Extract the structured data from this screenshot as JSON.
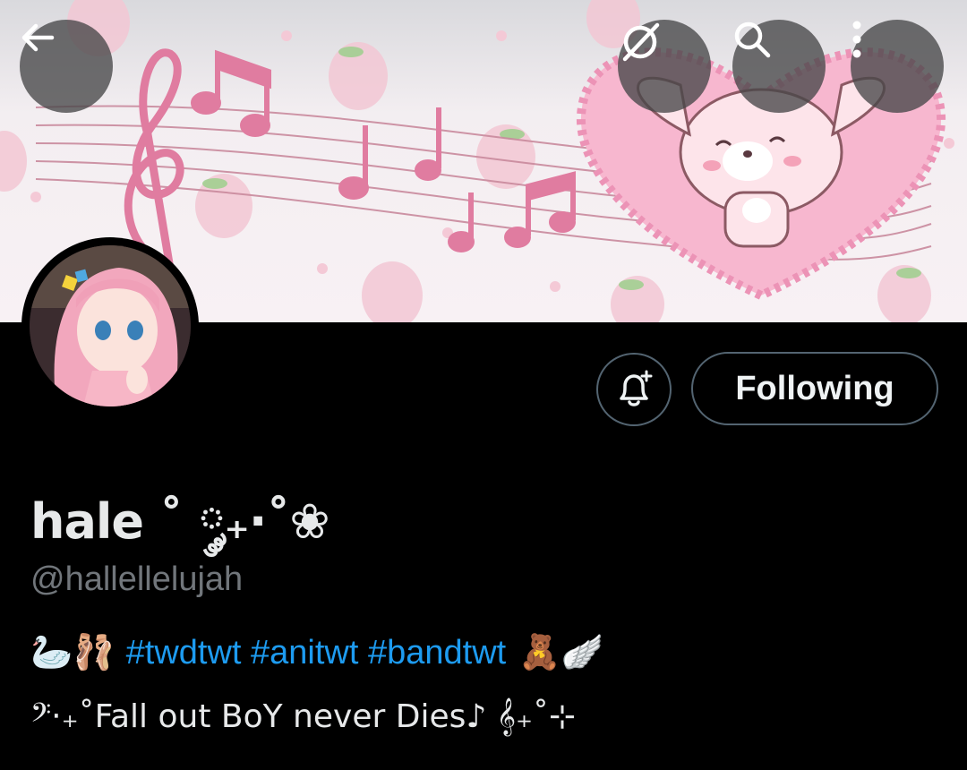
{
  "header": {
    "back_icon": "arrow-left-icon",
    "grok_icon": "grok-icon",
    "search_icon": "search-icon",
    "more_icon": "more-vertical-icon"
  },
  "profile": {
    "display_name": "hale ˚ ༘₊·˚❀",
    "handle": "@hallellelujah",
    "follow_label": "Following",
    "notify_icon": "bell-plus-icon",
    "bio_line1": {
      "lead_emoji": "🦢🩰",
      "hashtags": "#twdtwt #anitwt #bandtwt",
      "trail_emoji": "🧸🪽"
    },
    "bio_line2": "𝄢⋅₊˚Fall out BoY never Dies♪ 𝄞₊˚⊹"
  },
  "colors": {
    "background": "#000000",
    "link": "#1d9bf0",
    "secondary_text": "#71767b",
    "border": "#536471"
  }
}
